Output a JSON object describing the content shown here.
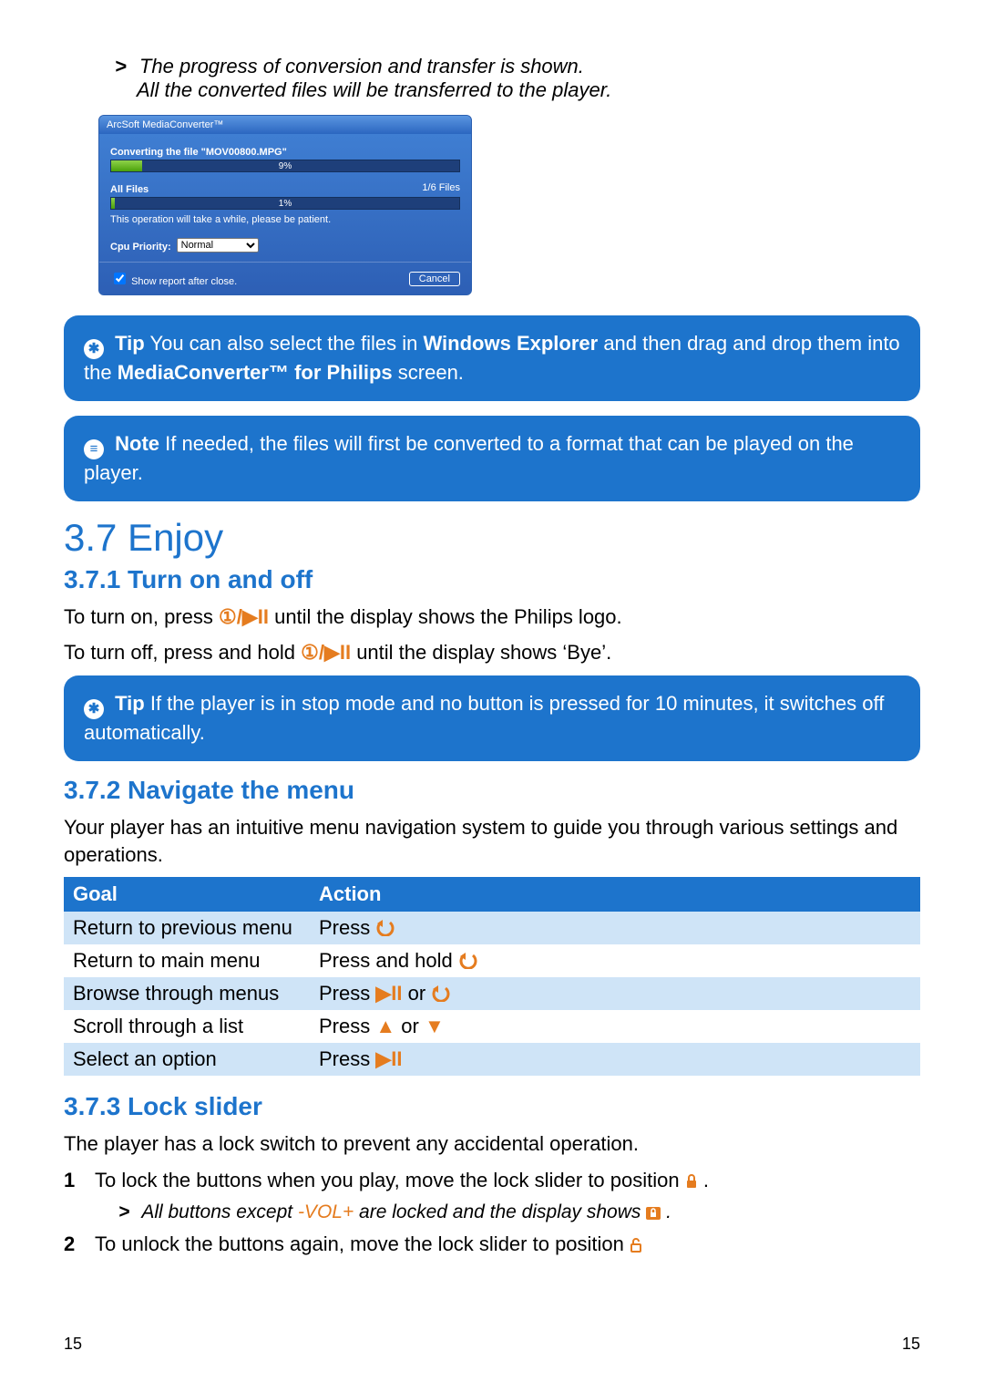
{
  "intro": {
    "line1": "The progress of conversion and transfer is shown.",
    "line2": "All the converted files will be transferred to the player."
  },
  "dialog": {
    "title": "ArcSoft MediaConverter™",
    "convLabel": "Converting the file \"MOV00800.MPG\"",
    "convPct": "9%",
    "allFilesLabel": "All Files",
    "allFilesRight": "1/6 Files",
    "allFilesPct": "1%",
    "patient": "This operation will take a while, please be patient.",
    "cpuLabel": "Cpu Priority:",
    "cpuValue": "Normal",
    "showReport": "Show report after close.",
    "cancel": "Cancel"
  },
  "tip1_a": "You can also select the files in ",
  "tip1_bold1": "Windows Explorer",
  "tip1_b": " and then drag and drop them into the ",
  "tip1_bold2": "MediaConverter™ for Philips",
  "tip1_c": " screen.",
  "note1": "If needed, the files will first be converted to a format that can be played on the player.",
  "h_enjoy": "3.7  Enjoy",
  "h_turn": "3.7.1 Turn on and off",
  "turn_on_a": "To turn on, press ",
  "turn_on_b": " until the display shows the Philips logo.",
  "turn_off_a": "To turn off, press and hold ",
  "turn_off_b": " until the display shows ‘Bye’.",
  "tip2": "If the player is in stop mode and no button is pressed for 10 minutes, it switches off automatically.",
  "h_nav": "3.7.2 Navigate the menu",
  "nav_intro": "Your player has an intuitive menu navigation system to guide you through various settings and operations.",
  "table": {
    "h_goal": "Goal",
    "h_action": "Action",
    "rows": [
      {
        "goal": "Return to previous menu",
        "action": "Press ",
        "icon": "back"
      },
      {
        "goal": "Return to main menu",
        "action": "Press and hold ",
        "icon": "back"
      },
      {
        "goal": "Browse through menus",
        "action": "Press ",
        "icon": "playpause_or_back"
      },
      {
        "goal": "Scroll through a list",
        "action": "Press ",
        "icon": "up_or_down"
      },
      {
        "goal": "Select an option",
        "action": "Press ",
        "icon": "playpause"
      }
    ]
  },
  "h_lock": "3.7.3 Lock slider",
  "lock_intro": "The player has a lock switch to prevent any accidental operation.",
  "lock_step1": "To lock the buttons when you play, move the lock slider to position ",
  "lock_sub_a": "All buttons except ",
  "lock_sub_vol": "-VOL+",
  "lock_sub_b": " are locked and the display shows ",
  "lock_step2": "To unlock the buttons again, move the lock slider to position ",
  "labels": {
    "tip": "Tip",
    "note": "Note"
  },
  "page_left": "15",
  "page_right": "15",
  "chart_data": {
    "type": "bar",
    "title": "ArcSoft MediaConverter progress dialog",
    "series": [
      {
        "name": "Converting MOV00800.MPG",
        "unit": "%",
        "value": 9
      },
      {
        "name": "All Files (1/6)",
        "unit": "%",
        "value": 1
      }
    ],
    "ylim": [
      0,
      100
    ]
  }
}
